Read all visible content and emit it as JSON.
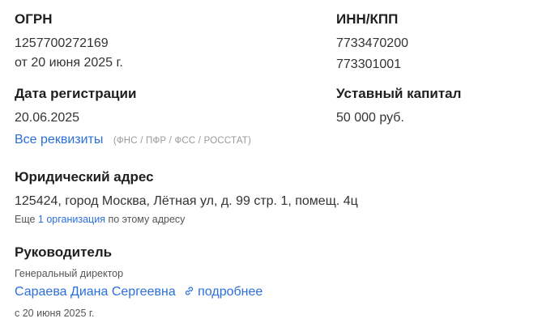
{
  "ogrn": {
    "label": "ОГРН",
    "number": "1257700272169",
    "date": "от 20 июня 2025 г."
  },
  "inn_kpp": {
    "label": "ИНН/КПП",
    "inn": "7733470200",
    "kpp": "773301001"
  },
  "registration": {
    "label": "Дата регистрации",
    "value": "20.06.2025"
  },
  "capital": {
    "label": "Уставный капитал",
    "value": "50 000 руб."
  },
  "requisites": {
    "link": "Все реквизиты",
    "note": "(ФНС / ПФР / ФСС / РОССТАТ)"
  },
  "address": {
    "label": "Юридический адрес",
    "value": "125424, город Москва, Лётная ул, д. 99 стр. 1, помещ. 4ц",
    "more_prefix": "Еще",
    "more_link": "1 организация",
    "more_suffix": "по этому адресу"
  },
  "director": {
    "label": "Руководитель",
    "position": "Генеральный директор",
    "name": "Сараева Диана Сергеевна",
    "details_link": "подробнее",
    "since": "с 20 июня 2025 г."
  },
  "colors": {
    "link": "#2a6fdb",
    "heading": "#1f1f1f",
    "muted": "#9a9a9a"
  }
}
